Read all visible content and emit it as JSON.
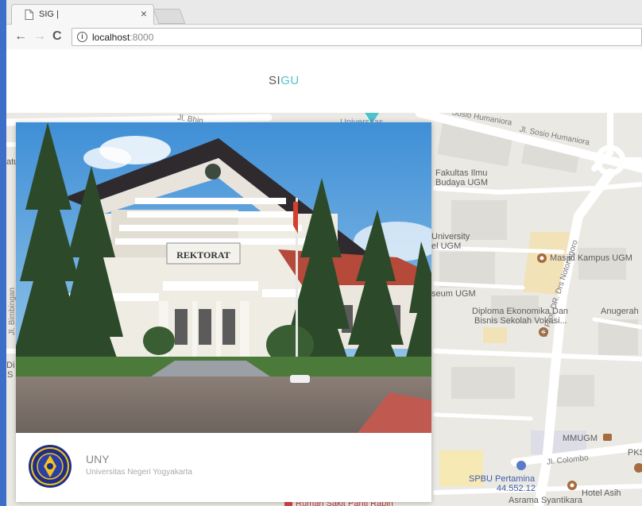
{
  "browser": {
    "tab_title": "SIG |",
    "tab_close": "×",
    "url_host": "localhost",
    "url_port": ":8000"
  },
  "header": {
    "brand_left": "SI",
    "brand_right": "GU"
  },
  "card": {
    "photo_sign": "REKTORAT",
    "title": "UNY",
    "subtitle": "Universitas Negeri Yogyakarta"
  },
  "map": {
    "labels": {
      "jl_bhin": "Jl. Bhin",
      "universitas": "Universitas",
      "sosio_humaniora_1": "Sosio Humaniora",
      "sosio_humaniora_2": "Jl. Sosio Humaniora",
      "fakultas_1": "Fakultas Ilmu",
      "fakultas_2": "Budaya UGM",
      "university_1": "University",
      "university_2": "el UGM",
      "masjid": "Masjid Kampus UGM",
      "museum": "seum UGM",
      "diploma_1": "Diploma Ekonomika Dan",
      "diploma_2": "Bisnis Sekolah Vokasi...",
      "notonagoro": "Jl. Prof. DR. Drs Notonagoro",
      "anugerah": "Anugerah",
      "mmugm": "MMUGM",
      "pks": "PKS",
      "colombo": "Jl. Colombo",
      "spbu_1": "SPBU Pertamina",
      "spbu_2": "44.552.12",
      "hotel": "Hotel Asih",
      "asrama": "Asrama Syantikara",
      "rumah_sakit": "Rumah Sakit Panti Rapih",
      "bimbingan": "Jl. Bimbingan",
      "atu": "atu",
      "di": "Di",
      "s": "S"
    }
  },
  "colors": {
    "accent": "#4ec3c9",
    "map_bg": "#ebe9e4",
    "window_frame": "#3d6fc9"
  }
}
